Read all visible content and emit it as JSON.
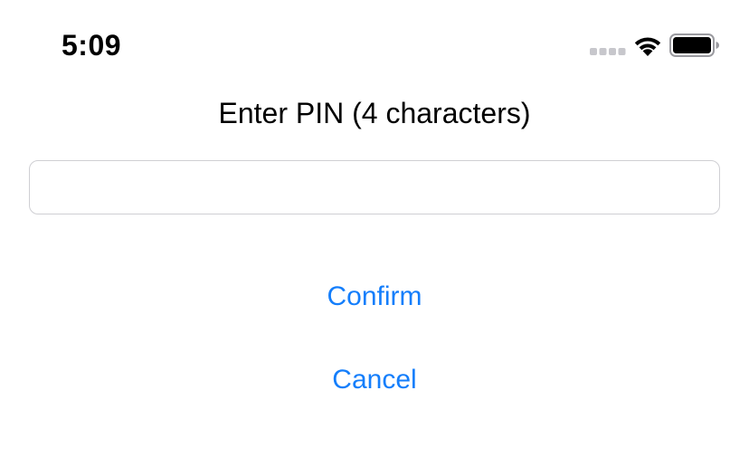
{
  "status_bar": {
    "time": "5:09",
    "icons": {
      "signal": "cellular-signal-icon",
      "wifi": "wifi-icon",
      "battery": "battery-icon"
    },
    "battery_level": 1.0
  },
  "prompt": {
    "title": "Enter PIN (4 characters)",
    "input_value": "",
    "input_placeholder": ""
  },
  "actions": {
    "confirm_label": "Confirm",
    "cancel_label": "Cancel"
  },
  "colors": {
    "accent": "#147efb",
    "text": "#000000",
    "field_border": "#cfcfd3",
    "signal_dots": "#c7c7cc"
  }
}
